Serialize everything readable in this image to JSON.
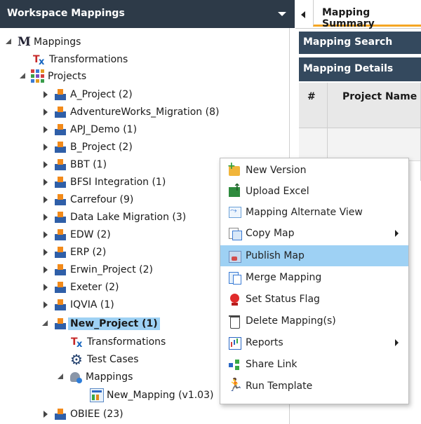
{
  "panel": {
    "title": "Workspace Mappings"
  },
  "tree": {
    "root": "Mappings",
    "root_transformations": "Transformations",
    "projects": "Projects",
    "items": [
      "A_Project (2)",
      "AdventureWorks_Migration (8)",
      "APJ_Demo (1)",
      "B_Project (2)",
      "BBT (1)",
      "BFSI Integration (1)",
      "Carrefour (9)",
      "Data Lake Migration (3)",
      "EDW (2)",
      "ERP (2)",
      "Erwin_Project (2)",
      "Exeter (2)",
      "IQVIA (1)"
    ],
    "selected_project": "New_Project (1)",
    "sub_transformations": "Transformations",
    "sub_test_cases": "Test Cases",
    "sub_mappings": "Mappings",
    "mapping": "New_Mapping (v1.03)",
    "last": "OBIEE (23)"
  },
  "right": {
    "tab": "Mapping Summary",
    "search_header": "Mapping Search",
    "details_header": "Mapping Details",
    "col_num": "#",
    "col_project": "Project Name"
  },
  "menu": {
    "new_version": "New Version",
    "upload_excel": "Upload Excel",
    "alt_view": "Mapping Alternate View",
    "copy_map": "Copy Map",
    "publish_map": "Publish Map",
    "merge": "Merge Mapping",
    "status_flag": "Set Status Flag",
    "delete": "Delete Mapping(s)",
    "reports": "Reports",
    "share": "Share Link",
    "run": "Run Template"
  },
  "colors": {
    "header_bg": "#2d3a48",
    "highlight": "#9ed1f4",
    "tab_accent": "#f5a623"
  }
}
